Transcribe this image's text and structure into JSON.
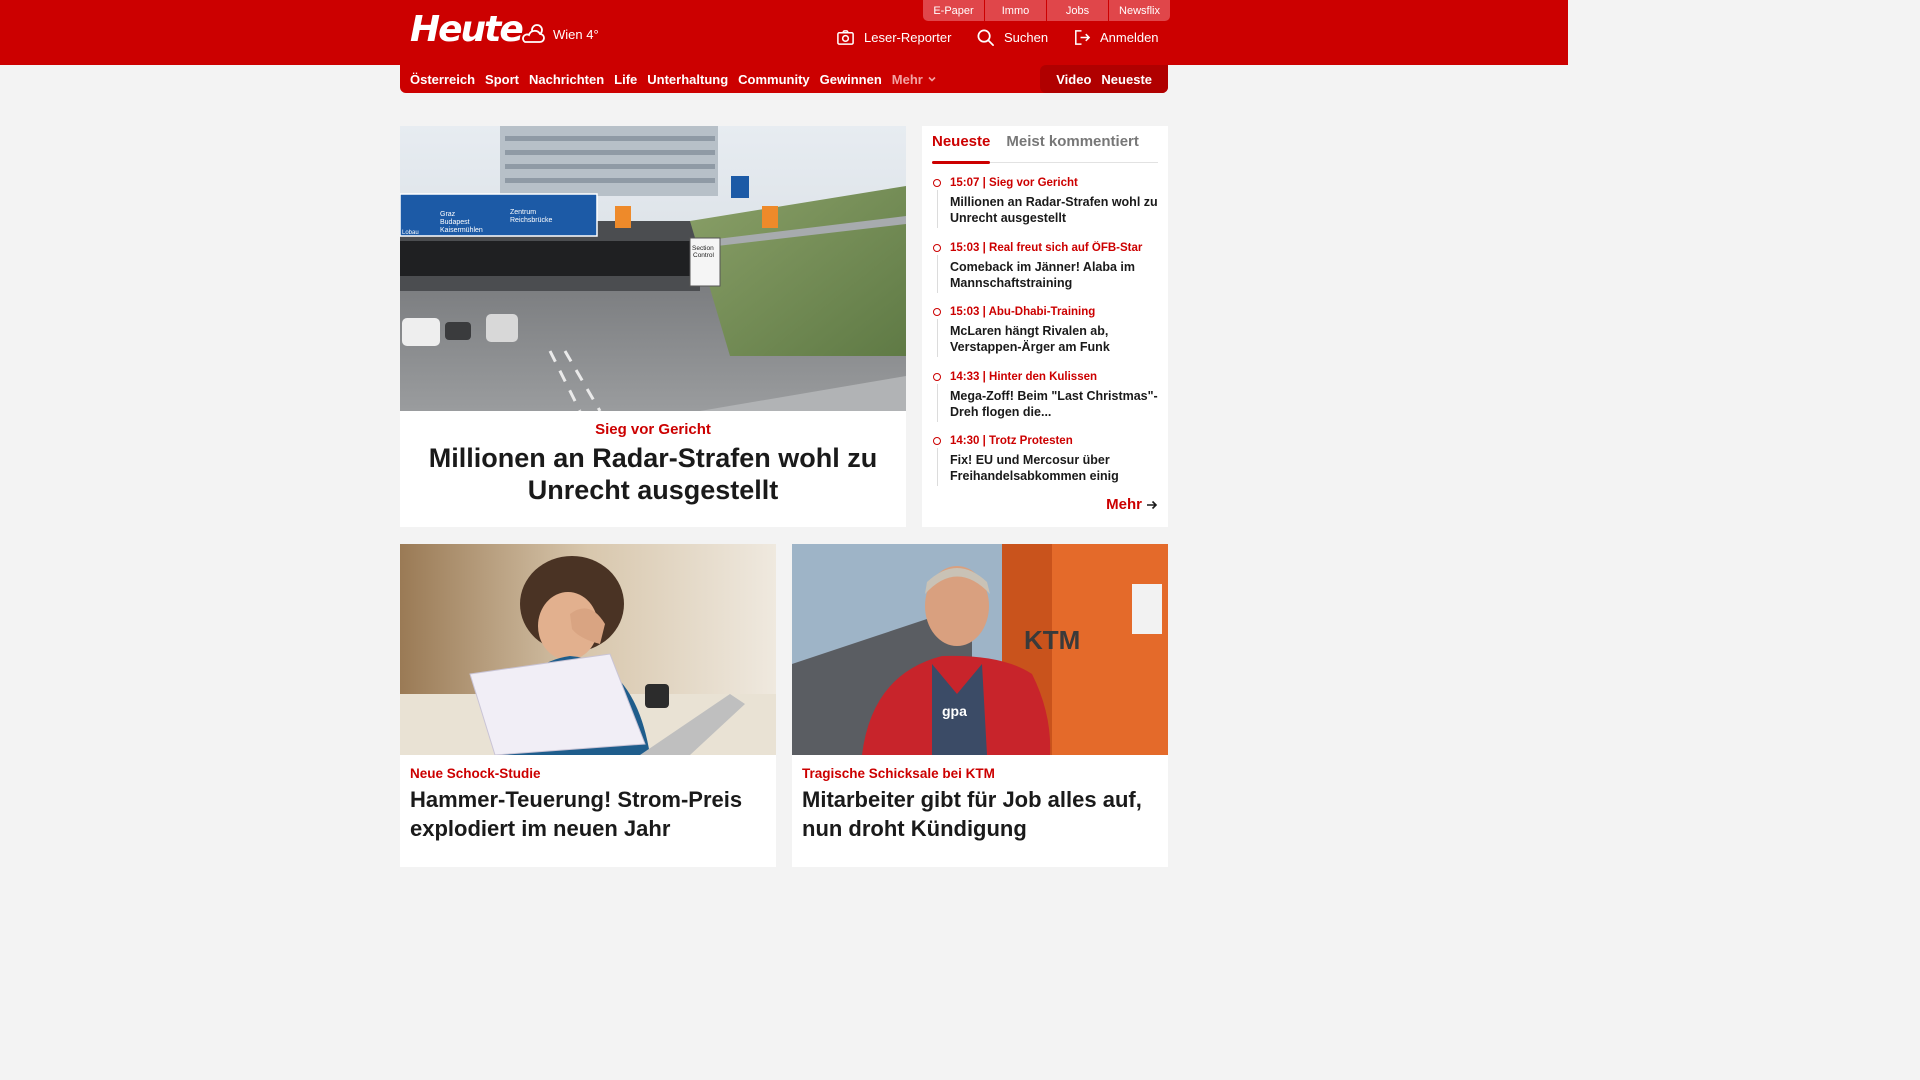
{
  "header": {
    "logo": "Heute",
    "weather": {
      "location_temp": "Wien 4°",
      "icon": "cloud-sun-icon"
    },
    "util_tabs": [
      "E-Paper",
      "Immo",
      "Jobs",
      "Newsflix"
    ],
    "actions": [
      {
        "label": "Leser-Reporter",
        "icon": "camera-icon"
      },
      {
        "label": "Suchen",
        "icon": "search-icon"
      },
      {
        "label": "Anmelden",
        "icon": "login-icon"
      }
    ]
  },
  "nav": {
    "items": [
      "Österreich",
      "Sport",
      "Nachrichten",
      "Life",
      "Unterhaltung",
      "Community",
      "Gewinnen"
    ],
    "more": "Mehr",
    "right": [
      "Video",
      "Neueste"
    ]
  },
  "hero": {
    "kicker": "Sieg vor Gericht",
    "title": "Millionen an Radar-Strafen wohl zu Unrecht ausgestellt",
    "image_text": {
      "sign_left_1": "Graz",
      "sign_left_2": "Budapest",
      "sign_left_3": "Kaisermühlen",
      "sign_left_4": "Lobau",
      "sign_right_1": "Zentrum",
      "sign_right_2": "Reichsbrücke",
      "section_1": "Section",
      "section_2": "Control"
    }
  },
  "sidebar": {
    "tabs": [
      "Neueste",
      "Meist kommentiert"
    ],
    "items": [
      {
        "meta": "15:07 | Sieg vor Gericht",
        "title": "Millionen an Radar-Strafen wohl zu Unrecht ausgestellt"
      },
      {
        "meta": "15:03 | Real freut sich auf ÖFB-Star",
        "title": "Comeback im Jänner! Alaba im Mannschaftstraining"
      },
      {
        "meta": "15:03 | Abu-Dhabi-Training",
        "title": "McLaren hängt Rivalen ab, Verstappen-Ärger am Funk"
      },
      {
        "meta": "14:33 | Hinter den Kulissen",
        "title": "Mega-Zoff! Beim \"Last Christmas\"-Dreh flogen die..."
      },
      {
        "meta": "14:30 | Trotz Protesten",
        "title": "Fix! EU und Mercosur über Freihandelsabkommen einig"
      }
    ],
    "more": "Mehr"
  },
  "cards": [
    {
      "kicker": "Neue Schock-Studie",
      "title": "Hammer-Teuerung! Strom-Preis explodiert im neuen Jahr"
    },
    {
      "kicker": "Tragische Schicksale bei KTM",
      "title": "Mitarbeiter gibt für Job alles auf, nun droht Kündigung",
      "image_text": {
        "building": "KTM",
        "jacket": "gpa"
      }
    }
  ],
  "colors": {
    "brand": "#cc0000",
    "brand_dark": "#b00000",
    "tab_bg": "#e0464a",
    "page_bg": "#f3f3f3"
  }
}
